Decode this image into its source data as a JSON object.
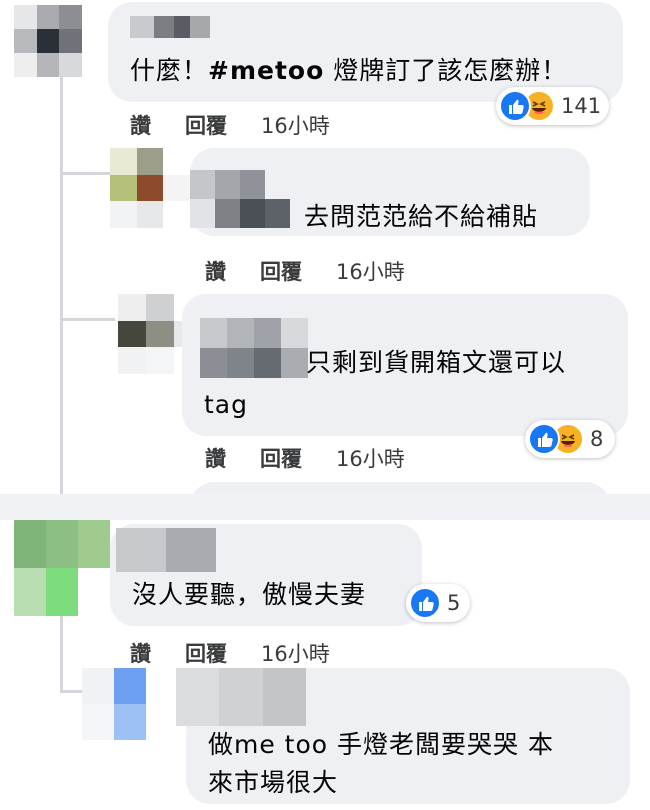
{
  "comments": [
    {
      "text": "什麼！#metoo 燈牌訂了該怎麼辦！",
      "text_plain": "什麼！",
      "text_hashtag": "#metoo",
      "text_rest": " 燈牌訂了該怎麼辦！",
      "like": "讚",
      "reply": "回覆",
      "time": "16小時",
      "reactions": [
        "like-icon",
        "haha-icon"
      ],
      "reaction_count": "141"
    },
    {
      "text": "去問范范給不給補貼",
      "like": "讚",
      "reply": "回覆",
      "time": "16小時"
    },
    {
      "text_line1": "只剩到貨開箱文還可以",
      "text_line2": "tag",
      "like": "讚",
      "reply": "回覆",
      "time": "16小時",
      "reactions": [
        "like-icon",
        "haha-icon"
      ],
      "reaction_count": "8"
    },
    {
      "text": "沒人要聽，傲慢夫妻",
      "like": "讚",
      "reply": "回覆",
      "time": "16小時",
      "reactions": [
        "like-icon"
      ],
      "reaction_count": "5"
    },
    {
      "text_line1": "做me too 手燈老闆要哭哭 本",
      "text_line2": "來市場很大"
    }
  ],
  "colors": {
    "bubble": "#eef0f4",
    "like_blue": "#1877f2",
    "haha_yellow": "#f7b125",
    "divider": "#f0f2f5"
  }
}
